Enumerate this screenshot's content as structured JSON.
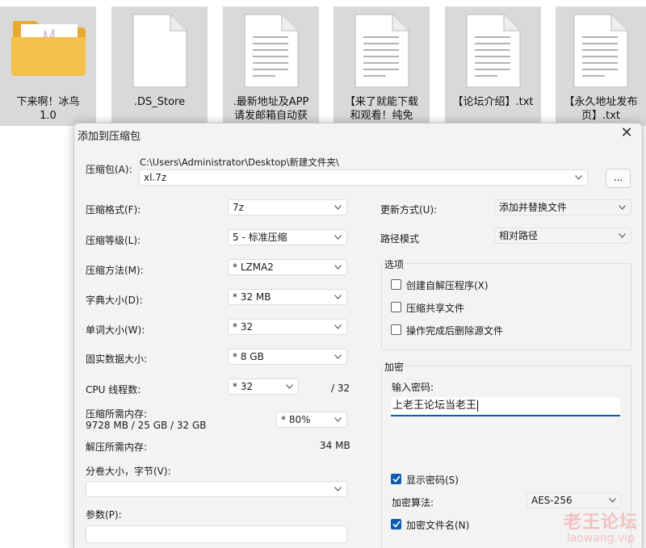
{
  "files": [
    {
      "name": "下来啊！冰鸟\n1.0",
      "icon": "folder-icon"
    },
    {
      "name": ".DS_Store",
      "icon": "file-icon"
    },
    {
      "name": ".最新地址及APP\n请发邮箱自动获",
      "icon": "text-file-icon"
    },
    {
      "name": "【来了就能下载\n和观看！纯免",
      "icon": "text-file-icon"
    },
    {
      "name": "【论坛介绍】.txt",
      "icon": "text-file-icon"
    },
    {
      "name": "【永久地址发布\n页】.txt",
      "icon": "text-file-icon"
    }
  ],
  "dialog": {
    "title": "添加到压缩包",
    "close_glyph": "✕",
    "archive": {
      "label": "压缩包(A):",
      "path": "C:\\Users\\Administrator\\Desktop\\新建文件夹\\",
      "name": "xl.7z",
      "browse_label": "..."
    },
    "left": {
      "format_label": "压缩格式(F):",
      "format": "7z",
      "level_label": "压缩等级(L):",
      "level": "5 - 标准压缩",
      "method_label": "压缩方法(M):",
      "method": "*  LZMA2",
      "dict_label": "字典大小(D):",
      "dict": "*  32 MB",
      "word_label": "单词大小(W):",
      "word": "*  32",
      "solid_label": "固实数据大小:",
      "solid": "*  8 GB",
      "cpu_label": "CPU 线程数:",
      "cpu": "*  32",
      "cpu_max": "/ 32",
      "mem_comp_label": "压缩所需内存:",
      "mem_comp_value": "9728 MB / 25 GB / 32 GB",
      "mem_percent": "*  80%",
      "mem_decomp_label": "解压所需内存:",
      "mem_decomp_value": "34 MB",
      "volume_label": "分卷大小，字节(V):",
      "volume": "",
      "params_label": "参数(P):",
      "params": ""
    },
    "right": {
      "update_label": "更新方式(U):",
      "update": "添加并替换文件",
      "pathmode_label": "路径模式",
      "pathmode": "相对路径",
      "options_title": "选项",
      "sfx_label": "创建自解压程序(X)",
      "sfx_checked": false,
      "shared_label": "压缩共享文件",
      "shared_checked": false,
      "delete_label": "操作完成后删除源文件",
      "delete_checked": false,
      "encryption_title": "加密",
      "password_label": "输入密码:",
      "password": "上老王论坛当老王",
      "show_password_label": "显示密码(S)",
      "show_password_checked": true,
      "algo_label": "加密算法:",
      "algo": "AES-256",
      "encrypt_names_label": "加密文件名(N)",
      "encrypt_names_checked": true
    }
  },
  "watermark": {
    "line1": "老王论坛",
    "line2": "laowang.vip"
  },
  "colors": {
    "accent": "#0b5cad",
    "tile_bg": "#d9d9d9",
    "dialog_bg": "#f3f3f3",
    "folder": "#f5c04a"
  }
}
